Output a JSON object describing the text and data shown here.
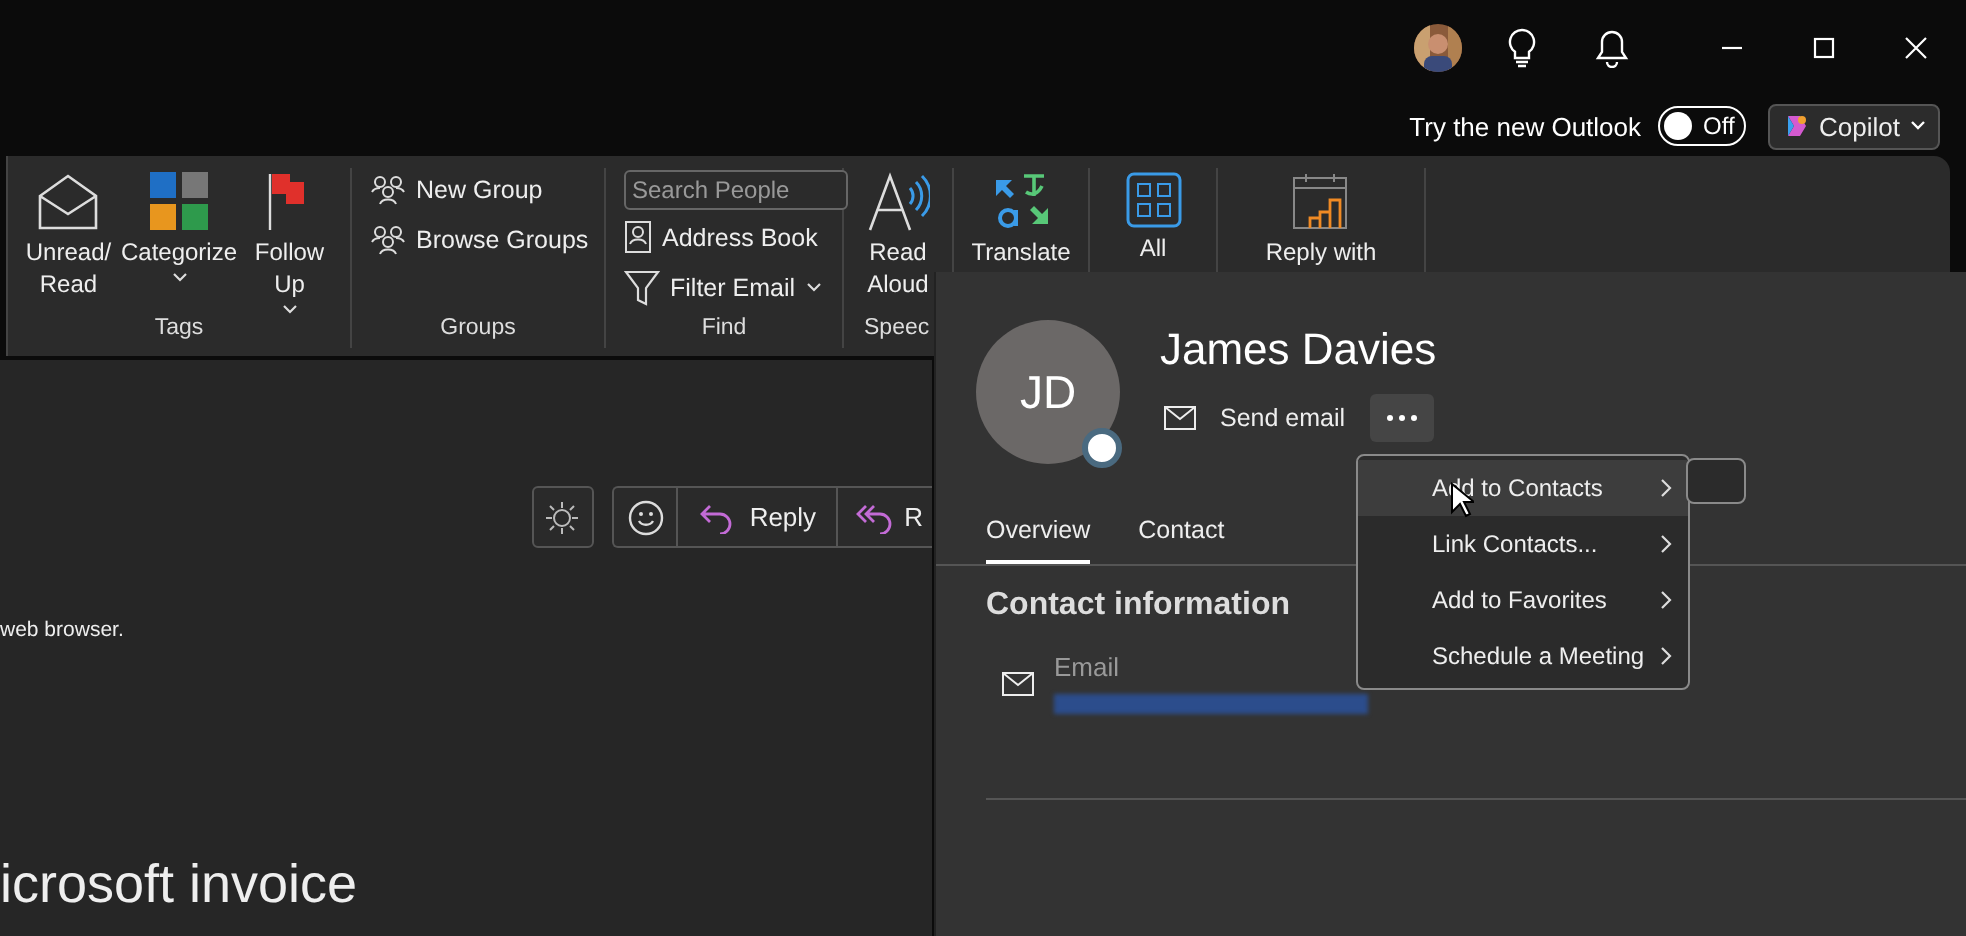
{
  "title_bar": {
    "try_label": "Try the new Outlook",
    "toggle": {
      "label": "Off",
      "on": false
    },
    "copilot": "Copilot"
  },
  "ribbon": {
    "groups": [
      {
        "label": "Tags",
        "commands": [
          "Unread/\nRead",
          "Categorize",
          "Follow\nUp"
        ]
      },
      {
        "label": "Groups",
        "commands": [
          "New Group",
          "Browse Groups"
        ]
      },
      {
        "label": "Find",
        "search_placeholder": "Search People",
        "commands": [
          "Address Book",
          "Filter Email"
        ]
      },
      {
        "label": "Speec",
        "commands": [
          "Read\nAloud"
        ]
      },
      {
        "commands": [
          "Translate"
        ]
      },
      {
        "commands": [
          "All"
        ]
      },
      {
        "commands": [
          "Reply with"
        ]
      }
    ]
  },
  "reading_pane": {
    "reply": "Reply",
    "reply_all": "R",
    "body_text": "web browser.",
    "subject": "icrosoft invoice"
  },
  "contact_card": {
    "initials": "JD",
    "name": "James Davies",
    "send_email": "Send email",
    "more_pressed": true,
    "tabs": [
      {
        "label": "Overview",
        "selected": true
      },
      {
        "label": "Contact",
        "selected": false
      }
    ],
    "section_title": "Contact information",
    "email_label": "Email",
    "menu": [
      {
        "label": "Add to Contacts",
        "highlighted": true
      },
      {
        "label": "Link Contacts...",
        "highlighted": false
      },
      {
        "label": "Add to Favorites",
        "highlighted": false
      },
      {
        "label": "Schedule a Meeting",
        "highlighted": false
      }
    ]
  }
}
